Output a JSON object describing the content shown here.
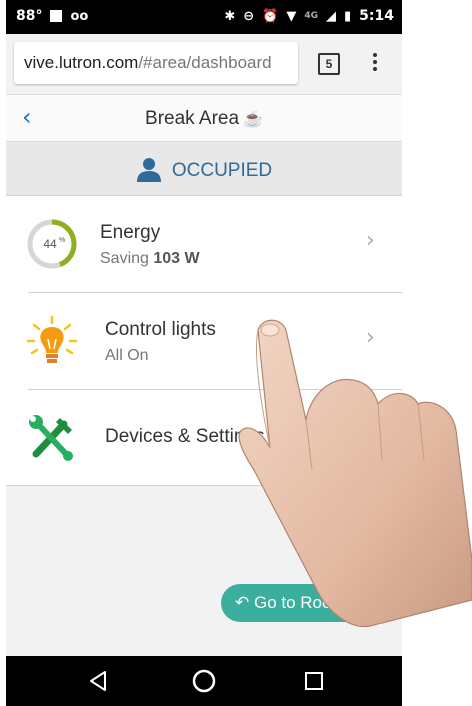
{
  "status_bar": {
    "temperature": "88°",
    "time": "5:14",
    "network": "4G"
  },
  "browser": {
    "url_host": "vive.lutron.com",
    "url_path": "/#area/dashboard",
    "tab_count": "5"
  },
  "header": {
    "title": "Break Area"
  },
  "occupancy": {
    "status": "OCCUPIED",
    "color": "#2e6a9a"
  },
  "rows": [
    {
      "label": "Energy",
      "sub_prefix": "Saving",
      "sub_value": "103 W",
      "gauge_percent": "44",
      "gauge_suffix": "%",
      "gauge_fraction": 0.44,
      "gauge_color": "#8cb020"
    },
    {
      "label": "Control lights",
      "sub": "All On",
      "icon": "lightbulb-icon"
    },
    {
      "label": "Devices & Settings",
      "icon": "tools-icon"
    }
  ],
  "go_to_button": {
    "label": "Go to Room",
    "color": "#3cae9e"
  },
  "colors": {
    "accent": "#1a73c8"
  }
}
